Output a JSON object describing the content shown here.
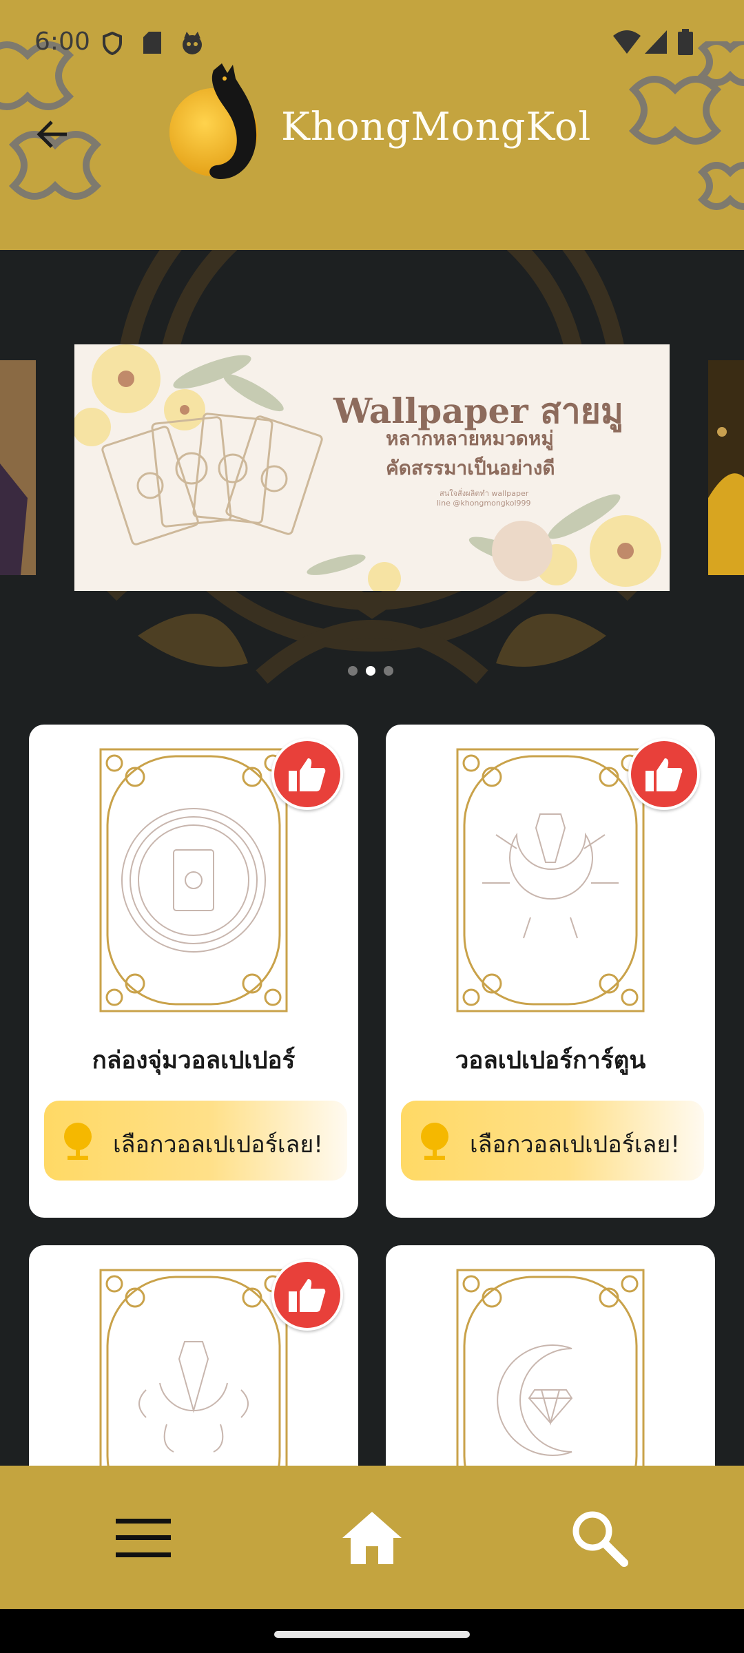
{
  "status_bar": {
    "time": "6:00"
  },
  "header": {
    "app_name": "KhongMongKol"
  },
  "banner": {
    "title": "Wallpaper สายมู",
    "line1": "หลากหลายหมวดหมู่",
    "line2": "คัดสรรมาเป็นอย่างดี",
    "small1": "สนใจสั่งผลิตทำ wallpaper",
    "small2": "line @khongmongkol999",
    "page_count": 3,
    "active_page": 2
  },
  "cards": [
    {
      "title": "กล่องจุ่มวอลเปเปอร์",
      "button_label": "เลือกวอลเปเปอร์เลย!",
      "liked": true
    },
    {
      "title": "วอลเปเปอร์การ์ตูน",
      "button_label": "เลือกวอลเปเปอร์เลย!",
      "liked": true
    },
    {
      "title": "",
      "button_label": "",
      "liked": true
    },
    {
      "title": "",
      "button_label": "",
      "liked": false
    }
  ],
  "bottom_nav": {
    "items": [
      "menu-icon",
      "home-icon",
      "search-icon"
    ]
  },
  "colors": {
    "header_bg": "#c4a43f",
    "page_bg": "#1d2021",
    "like_red": "#e8403a",
    "button_yellow": "#ffd965"
  }
}
